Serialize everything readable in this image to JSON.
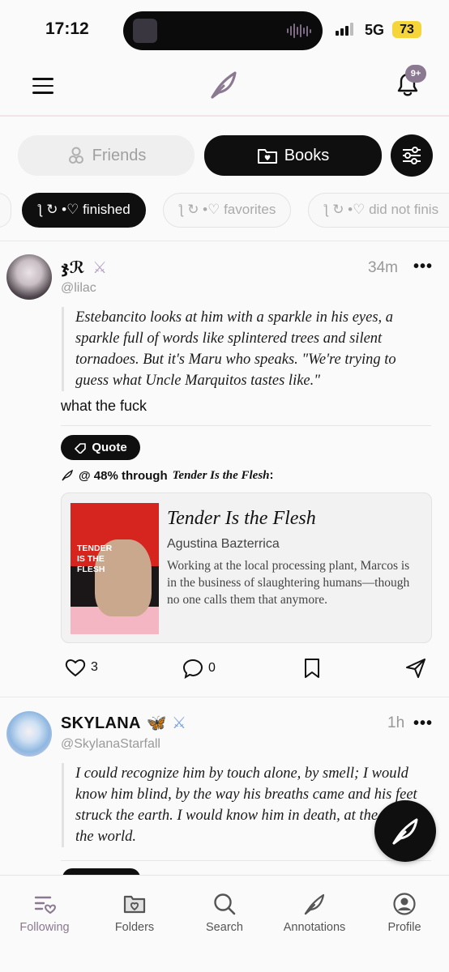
{
  "status_bar": {
    "time": "17:12",
    "network": "5G",
    "battery": "73"
  },
  "header": {
    "notification_badge": "9+"
  },
  "segments": {
    "friends": "Friends",
    "books": "Books"
  },
  "chips": [
    {
      "label": "ƪ ↻ •♡ finished"
    },
    {
      "label": "ƪ ↻ •♡ favorites"
    },
    {
      "label": "ƪ ↻ •♡ did not finis"
    }
  ],
  "posts": [
    {
      "username": "ჯℛ",
      "handle": "@lilac",
      "time": "34m",
      "quote": "Estebancito looks at him with a sparkle in his eyes, a sparkle full of words like splintered trees and silent tornadoes. But it's Maru who speaks. \"We're trying to guess what Uncle Marquitos tastes like.\"",
      "comment": "what the fuck",
      "quote_button": "Quote",
      "progress_prefix": "@ 48% through",
      "progress_title": "Tender Is the Flesh",
      "progress_suffix": ":",
      "book": {
        "title": "Tender Is the Flesh",
        "author": "Agustina Bazterrica",
        "description": "Working at the local processing plant, Marcos is in the business of slaughtering humans—though no one calls them that anymore.",
        "cover_text": "TENDER IS THE FLESH"
      },
      "likes": "3",
      "comments": "0"
    },
    {
      "username": "SKYLANA",
      "handle": "@SkylanaStarfall",
      "time": "1h",
      "quote": "I could recognize him by touch alone, by smell; I would know him blind, by the way his breaths came and his feet struck the earth. I would know him in death, at the end of the world."
    }
  ],
  "tabs": [
    {
      "label": "Following"
    },
    {
      "label": "Folders"
    },
    {
      "label": "Search"
    },
    {
      "label": "Annotations"
    },
    {
      "label": "Profile"
    }
  ],
  "colors": {
    "accent": "#8a7990",
    "dark": "#0f0f0f",
    "battery": "#f5d53a"
  }
}
